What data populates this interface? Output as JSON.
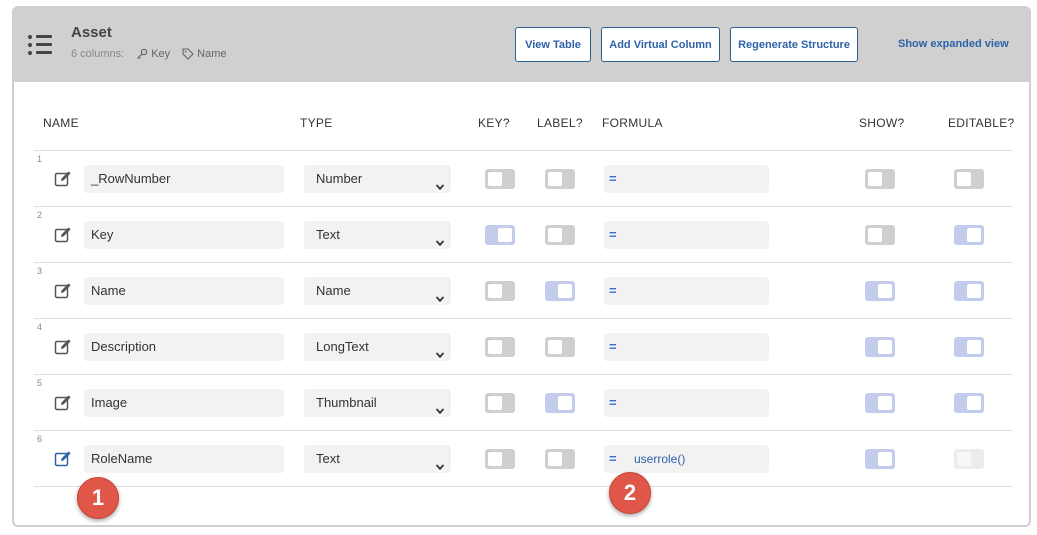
{
  "header": {
    "title": "Asset",
    "columns_count": "6 columns:",
    "key_tag": "Key",
    "label_tag": "Name",
    "buttons": {
      "view_table": "View Table",
      "add_virtual_column": "Add Virtual Column",
      "regenerate_structure": "Regenerate Structure",
      "show_expanded_view": "Show expanded view"
    }
  },
  "columns": {
    "name": "NAME",
    "type": "TYPE",
    "key": "KEY?",
    "label": "LABEL?",
    "formula": "FORMULA",
    "show": "SHOW?",
    "editable": "EDITABLE?"
  },
  "rows": [
    {
      "num": "1",
      "name": "_RowNumber",
      "type": "Number",
      "key": "off",
      "label": "off",
      "formula": "",
      "show": "off",
      "editable": "off"
    },
    {
      "num": "2",
      "name": "Key",
      "type": "Text",
      "key": "on",
      "label": "off",
      "formula": "",
      "show": "off",
      "editable": "on"
    },
    {
      "num": "3",
      "name": "Name",
      "type": "Name",
      "key": "off",
      "label": "on",
      "formula": "",
      "show": "on",
      "editable": "on"
    },
    {
      "num": "4",
      "name": "Description",
      "type": "LongText",
      "key": "off",
      "label": "off",
      "formula": "",
      "show": "on",
      "editable": "on"
    },
    {
      "num": "5",
      "name": "Image",
      "type": "Thumbnail",
      "key": "off",
      "label": "on",
      "formula": "",
      "show": "on",
      "editable": "on"
    },
    {
      "num": "6",
      "name": "RoleName",
      "type": "Text",
      "key": "off",
      "label": "off",
      "formula": "userrole()",
      "show": "on",
      "editable": "disabled"
    }
  ],
  "callouts": [
    "1",
    "2"
  ],
  "colors": {
    "header_bg": "#d0d0d0",
    "accent": "#2d62a8",
    "toggle_on": "#c3cceb",
    "toggle_off": "#cfcfcf",
    "callout": "#e0574a"
  }
}
